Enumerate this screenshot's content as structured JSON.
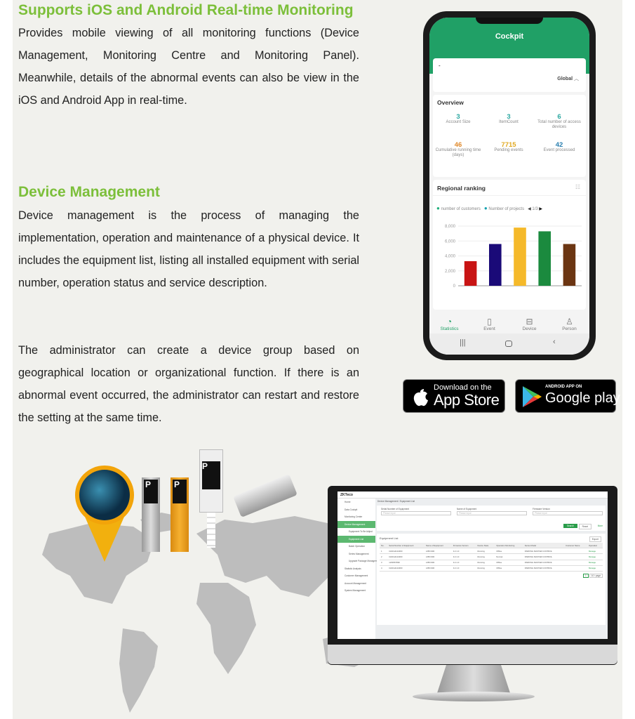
{
  "section1": {
    "title": "Supports iOS and Android Real-time Monitoring",
    "body": "Provides mobile viewing of all monitoring functions (Device Management, Monitoring Centre and Monitoring Panel). Meanwhile, details of the abnormal events can also be view in the iOS and Android App in real-time."
  },
  "section2": {
    "title": "Device Management",
    "body1": "Device management is the process of managing the implementation, operation and maintenance of a physical device. It includes the equipment list, listing all installed equipment with serial number, operation status and service description.",
    "body2": "The administrator can create a device group based on geographical location or organizational function. If there is an abnormal event occurred, the administrator can restart and restore the setting at the same time."
  },
  "phone": {
    "header": "Cockpit",
    "dash": "-",
    "scope": "Global",
    "overview": {
      "title": "Overview",
      "stats": [
        {
          "value": "3",
          "label": "Account Size",
          "color": "#2aa7a0"
        },
        {
          "value": "3",
          "label": "ItemCount",
          "color": "#2aa7a0"
        },
        {
          "value": "6",
          "label": "Total number of access devices",
          "color": "#2aa7a0"
        },
        {
          "value": "46",
          "label": "Cumulative running time (days)",
          "color": "#e08a2c"
        },
        {
          "value": "7715",
          "label": "Pending events",
          "color": "#e0a820"
        },
        {
          "value": "42",
          "label": "Event processed",
          "color": "#2a7fb0"
        }
      ]
    },
    "ranking": {
      "title": "Regional ranking",
      "legend": [
        "number of customers",
        "Number of projects"
      ],
      "page": "1/3"
    },
    "nav": [
      {
        "label": "Statistics",
        "icon": "pie-chart-icon",
        "active": true
      },
      {
        "label": "Event",
        "icon": "document-icon"
      },
      {
        "label": "Device",
        "icon": "device-icon"
      },
      {
        "label": "Person",
        "icon": "person-icon"
      }
    ]
  },
  "chart_data": {
    "type": "bar",
    "categories": [
      "",
      "",
      "",
      "",
      ""
    ],
    "values": [
      3300,
      5600,
      7800,
      7300,
      5600
    ],
    "colors": [
      "#c81414",
      "#1a0a78",
      "#f5b92a",
      "#1b8a3e",
      "#6b3512"
    ],
    "yticks": [
      "0",
      "2,000",
      "4,000",
      "6,000",
      "8,000"
    ],
    "ylim": [
      0,
      8000
    ],
    "grid": true
  },
  "badges": {
    "apple_small": "Download on the",
    "apple_big": "App Store",
    "google_small": "ANDROID APP ON",
    "google_big": "Google",
    "google_play": "play"
  },
  "monitor": {
    "logo": "ZKTeco",
    "breadcrumb": "Device Management / Equipment List",
    "sidebar": [
      "Home",
      "Data Cockpit",
      "Monitoring Center",
      "Device Management",
      "Equipment To Be Adjust",
      "Equipment List",
      "Batch Operation",
      "Series Management",
      "Upgrade Package Management",
      "Statistic Analysis",
      "Customer Management",
      "Account Management",
      "System Management"
    ],
    "filters": [
      "Serial Number of Equipment",
      "Name of Equipment",
      "Firmware Version"
    ],
    "placeholder": "Please input",
    "search": "Search",
    "reset": "Reset",
    "more": "More",
    "list_title": "Equipment List",
    "export": "Export",
    "columns": [
      "No.",
      "Serial Number of Equipment",
      "Name of Equipment",
      "Firmware Version",
      "Device State",
      "Operation Monitoring",
      "Series Model",
      "Customer Name",
      "Operation"
    ],
    "rows": [
      [
        "1",
        "CHNG2124000",
        "LPRC300",
        "3.2.1.0",
        "Running",
        "Offline",
        "PARKING MASTER CONTROL",
        "",
        "Manage"
      ],
      [
        "2",
        "CHNG2124000",
        "LPRC300",
        "3.2.1.0",
        "Running",
        "Normal",
        "PARKING MASTER CONTROL",
        "",
        "Manage"
      ],
      [
        "3",
        "1234567890",
        "LPRC300",
        "3.2.1.0",
        "Running",
        "Offline",
        "PARKING MASTER CONTROL",
        "",
        "Manage"
      ],
      [
        "4",
        "CHNG2124000",
        "LPRC300",
        "3.2.1.0",
        "Running",
        "Offline",
        "PARKING MASTER CONTROL",
        "",
        "Manage"
      ]
    ],
    "pager": "1",
    "page_size": "10 / page"
  }
}
